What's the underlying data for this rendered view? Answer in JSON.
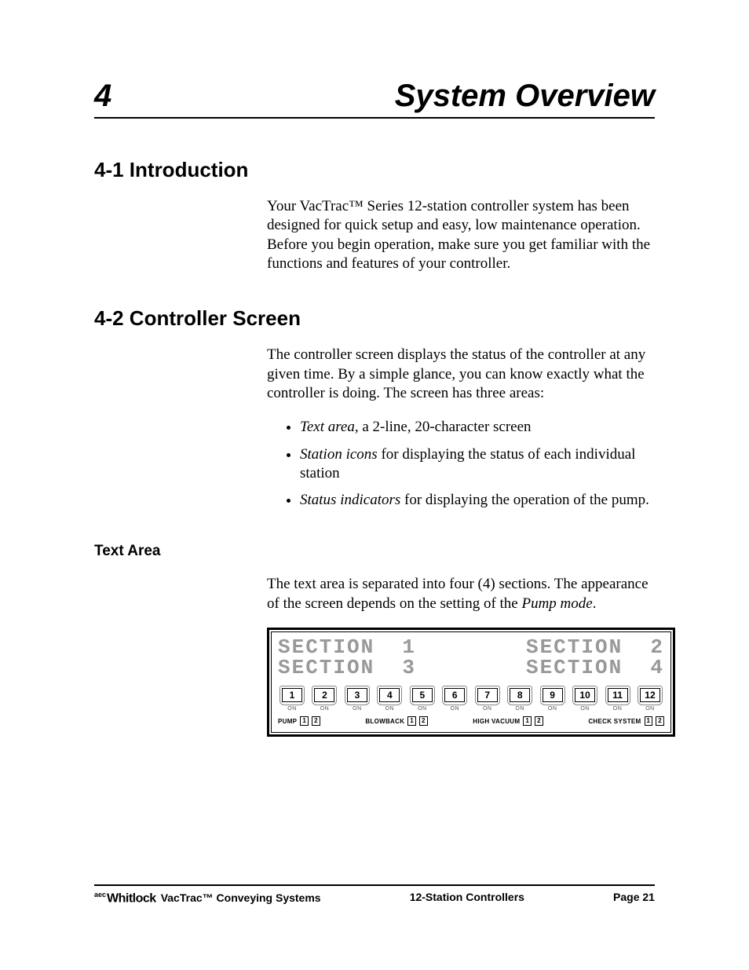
{
  "chapter": {
    "number": "4",
    "title": "System Overview"
  },
  "sections": {
    "s1": {
      "heading": "4-1   Introduction",
      "p1": "Your VacTrac™ Series 12-station controller system has been designed for quick setup and easy, low maintenance operation. Before you begin operation, make sure you get familiar with the functions and features of your controller."
    },
    "s2": {
      "heading": "4-2   Controller Screen",
      "p1": "The controller screen displays the status of the controller at any given time. By a simple glance, you can know exactly what the controller is doing. The screen has three areas:",
      "bullets": {
        "b1_em": "Text area",
        "b1_rest": ", a 2-line, 20-character screen",
        "b2_em": "Station icons",
        "b2_rest": " for displaying the status of each individual station",
        "b3_em": "Status indicators",
        "b3_rest": " for displaying the operation of the pump."
      }
    },
    "textarea": {
      "heading": "Text Area",
      "p1a": "The text area is separated into four (4) sections. The appearance of the screen depends on the setting of the ",
      "p1em": "Pump mode",
      "p1b": "."
    }
  },
  "panel": {
    "lcd": {
      "r1a": "SECTION  1",
      "r1b": "SECTION  2",
      "r2a": "SECTION  3",
      "r2b": "SECTION  4"
    },
    "stations": [
      "1",
      "2",
      "3",
      "4",
      "5",
      "6",
      "7",
      "8",
      "9",
      "10",
      "11",
      "12"
    ],
    "on_label": "ON",
    "status": {
      "pump": "PUMP",
      "blowback": "BLOWBACK",
      "highvac": "HIGH VACUUM",
      "check": "CHECK SYSTEM",
      "n1": "1",
      "n2": "2"
    }
  },
  "footer": {
    "brand_prefix": "aec",
    "brand": "Whitlock",
    "left": " VacTrac™ Conveying Systems",
    "center": "12-Station Controllers",
    "right": "Page 21"
  }
}
